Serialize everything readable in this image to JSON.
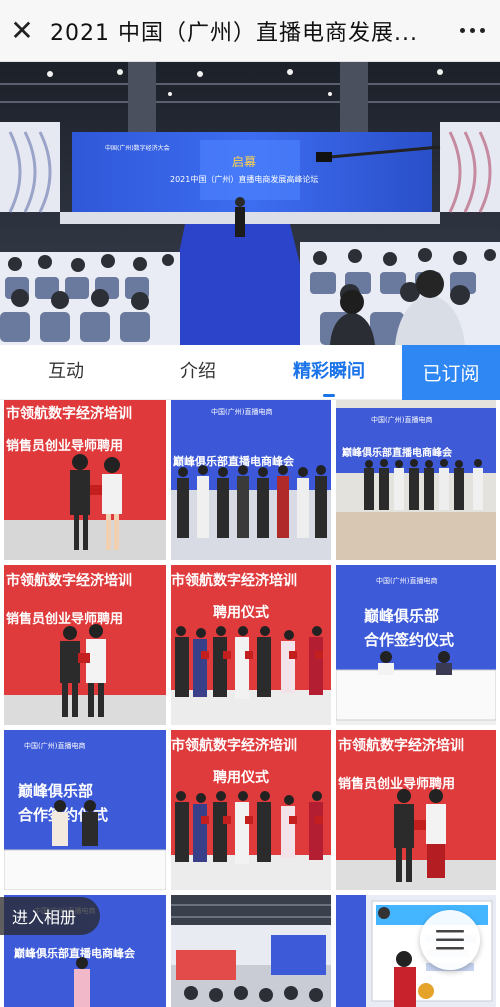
{
  "header": {
    "close_glyph": "✕",
    "title": "2021 中国（广州）直播电商发展..."
  },
  "hero": {
    "banner_line1": "中国(广州)数字经济大会",
    "banner_line2": "2021中国（广州）直播电商发展高峰论坛",
    "stage_logo": "启幕"
  },
  "tabs": [
    {
      "label": "互动"
    },
    {
      "label": "介绍"
    },
    {
      "label": "精彩瞬间"
    }
  ],
  "subscribe_label": "已订阅",
  "photos": [
    {
      "banner": "市领航数字经济培训",
      "sub": "销售员创业导师聘用"
    },
    {
      "banner": "中国(广州)直播电商",
      "sub": "巅峰俱乐部直播电商峰会"
    },
    {
      "banner": "中国(广州)直播电商",
      "sub": "巅峰俱乐部直播电商峰会"
    },
    {
      "banner": "市领航数字经济培训",
      "sub": "销售员创业导师聘用"
    },
    {
      "banner": "市领航数字经济培训",
      "sub": "聘用仪式"
    },
    {
      "banner": "巅峰俱乐部",
      "sub": "合作签约仪式"
    },
    {
      "banner": "巅峰俱乐部",
      "sub": "合作签约仪式"
    },
    {
      "banner": "市领航数字经济培训",
      "sub": "聘用仪式"
    },
    {
      "banner": "市领航数字经济培训",
      "sub": "销售员创业导师聘用"
    },
    {
      "banner": "巅峰俱乐部直播电商峰会",
      "sub": ""
    },
    {
      "banner": "",
      "sub": ""
    },
    {
      "banner": "",
      "sub": ""
    }
  ],
  "album_label": "进入相册",
  "menu_icon": "hamburger-menu-icon",
  "colors": {
    "accent": "#2e87f2",
    "active_tab": "#1a73e8",
    "red_banner": "#e03a3a",
    "blue_banner": "#3a55d6"
  }
}
